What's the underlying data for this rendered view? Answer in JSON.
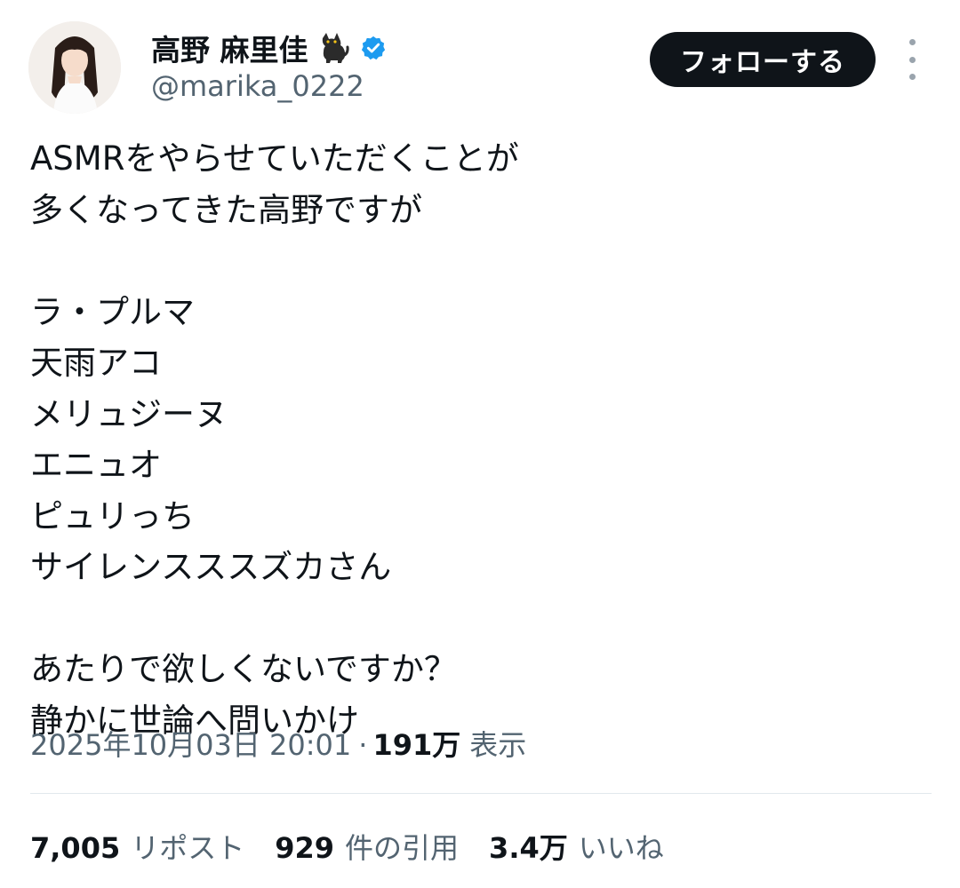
{
  "author": {
    "display_name": "高野 麻里佳",
    "handle": "@marika_0222",
    "name_emoji_icon": "black-cat-icon",
    "verified_icon": "verified-badge-icon"
  },
  "follow_button": {
    "label": "フォローする"
  },
  "more_menu": {
    "icon": "more-vertical-icon"
  },
  "tweet": {
    "lines": [
      "ASMRをやらせていただくことが",
      "多くなってきた高野ですが",
      "",
      "ラ・プルマ",
      "天雨アコ",
      "メリュジーヌ",
      "エニュオ",
      "ピュリっち",
      "サイレンスススズカさん",
      "",
      "あたりで欲しくないですか？",
      "静かに世論へ問いかけ"
    ]
  },
  "meta": {
    "timestamp": "2025年10月03日 20:01",
    "separator": "·",
    "views_count": "191万",
    "views_label": "表示"
  },
  "stats": {
    "reposts_count": "7,005",
    "reposts_label": "リポスト",
    "quotes_count": "929",
    "quotes_label": "件の引用",
    "likes_count": "3.4万",
    "likes_label": "いいね"
  },
  "colors": {
    "text_primary": "#0f1419",
    "text_secondary": "#536471",
    "verified_blue": "#1d9bf0",
    "button_bg": "#0f1419",
    "divider": "#e1e8ed"
  }
}
